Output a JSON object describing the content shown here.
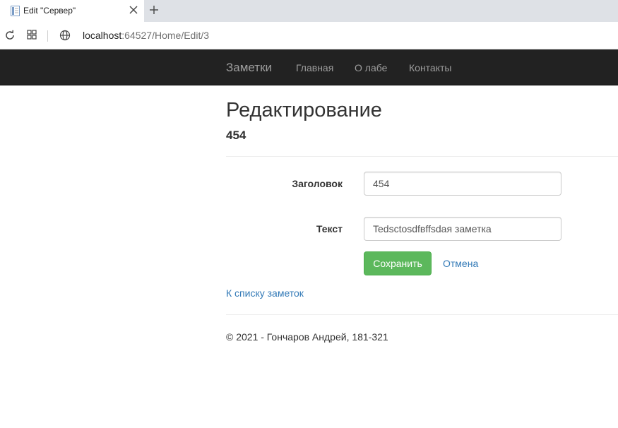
{
  "browser": {
    "tab_title": "Edit \"Сервер\"",
    "url_host": "localhost",
    "url_rest": ":64527/Home/Edit/3"
  },
  "navbar": {
    "brand": "Заметки",
    "links": [
      "Главная",
      "О лабе",
      "Контакты"
    ]
  },
  "page": {
    "title": "Редактирование",
    "subtitle": "454"
  },
  "form": {
    "title_label": "Заголовок",
    "title_value": "454",
    "text_label": "Текст",
    "text_value": "Tedsctosdfвffsdaя заметка",
    "save_label": "Сохранить",
    "cancel_label": "Отмена"
  },
  "back_link": "К списку заметок",
  "footer": "© 2021 - Гончаров Андрей, 181-321",
  "colors": {
    "navbar_bg": "#222222",
    "nav_text": "#9d9d9d",
    "save_button": "#5cb85c",
    "link": "#337ab7"
  },
  "icons": [
    "page-favicon-icon",
    "close-icon",
    "plus-icon",
    "reload-icon",
    "apps-grid-icon",
    "globe-icon"
  ]
}
